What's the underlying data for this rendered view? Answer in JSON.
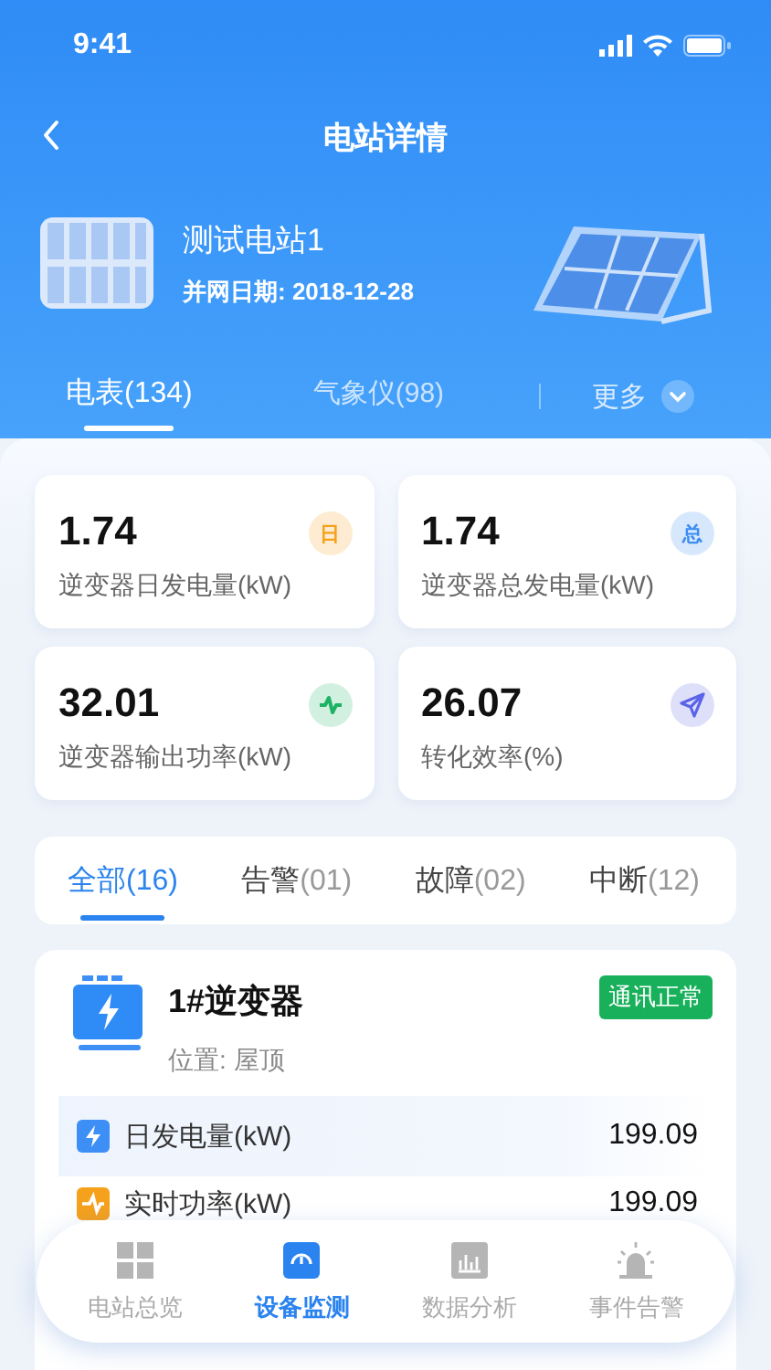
{
  "status_bar": {
    "time": "9:41"
  },
  "nav": {
    "title": "电站详情"
  },
  "station": {
    "name": "测试电站1",
    "grid_date": "并网日期: 2018-12-28"
  },
  "device_tabs": [
    {
      "label": "电表(134)",
      "selected": true
    },
    {
      "label": "气象仪(98)",
      "selected": false
    }
  ],
  "more": {
    "label": "更多"
  },
  "stats": [
    {
      "value": "1.74",
      "label": "逆变器日发电量(kW)",
      "badge": {
        "kind": "text",
        "text": "日",
        "color": "#f5a11c"
      }
    },
    {
      "value": "1.74",
      "label": "逆变器总发电量(kW)",
      "badge": {
        "kind": "text",
        "text": "总",
        "color": "#3b8df2"
      }
    },
    {
      "value": "32.01",
      "label": "逆变器输出功率(kW)",
      "badge": {
        "kind": "pulse",
        "color": "#1fb265"
      }
    },
    {
      "value": "26.07",
      "label": "转化效率(%)",
      "badge": {
        "kind": "send",
        "color": "#5b63e8"
      }
    }
  ],
  "filters": [
    {
      "label": "全部",
      "count": "(16)",
      "selected": true
    },
    {
      "label": "告警",
      "count": "(01)",
      "selected": false
    },
    {
      "label": "故障",
      "count": "(02)",
      "selected": false
    },
    {
      "label": "中断",
      "count": "(12)",
      "selected": false
    }
  ],
  "device": {
    "name": "1#逆变器",
    "location": "位置: 屋顶",
    "status": "通讯正常",
    "metrics": [
      {
        "label": "日发电量(kW)",
        "value": "199.09",
        "kind": "bolt",
        "color": "#3d8ef5",
        "highlighted": true
      },
      {
        "label": "实时功率(kW)",
        "value": "199.09",
        "kind": "power",
        "color": "#f5a11c",
        "highlighted": false
      }
    ]
  },
  "bottom_nav": [
    {
      "label": "电站总览",
      "kind": "grid",
      "selected": false
    },
    {
      "label": "设备监测",
      "kind": "gauge",
      "selected": true
    },
    {
      "label": "数据分析",
      "kind": "chart",
      "selected": false
    },
    {
      "label": "事件告警",
      "kind": "alarm",
      "selected": false
    }
  ]
}
